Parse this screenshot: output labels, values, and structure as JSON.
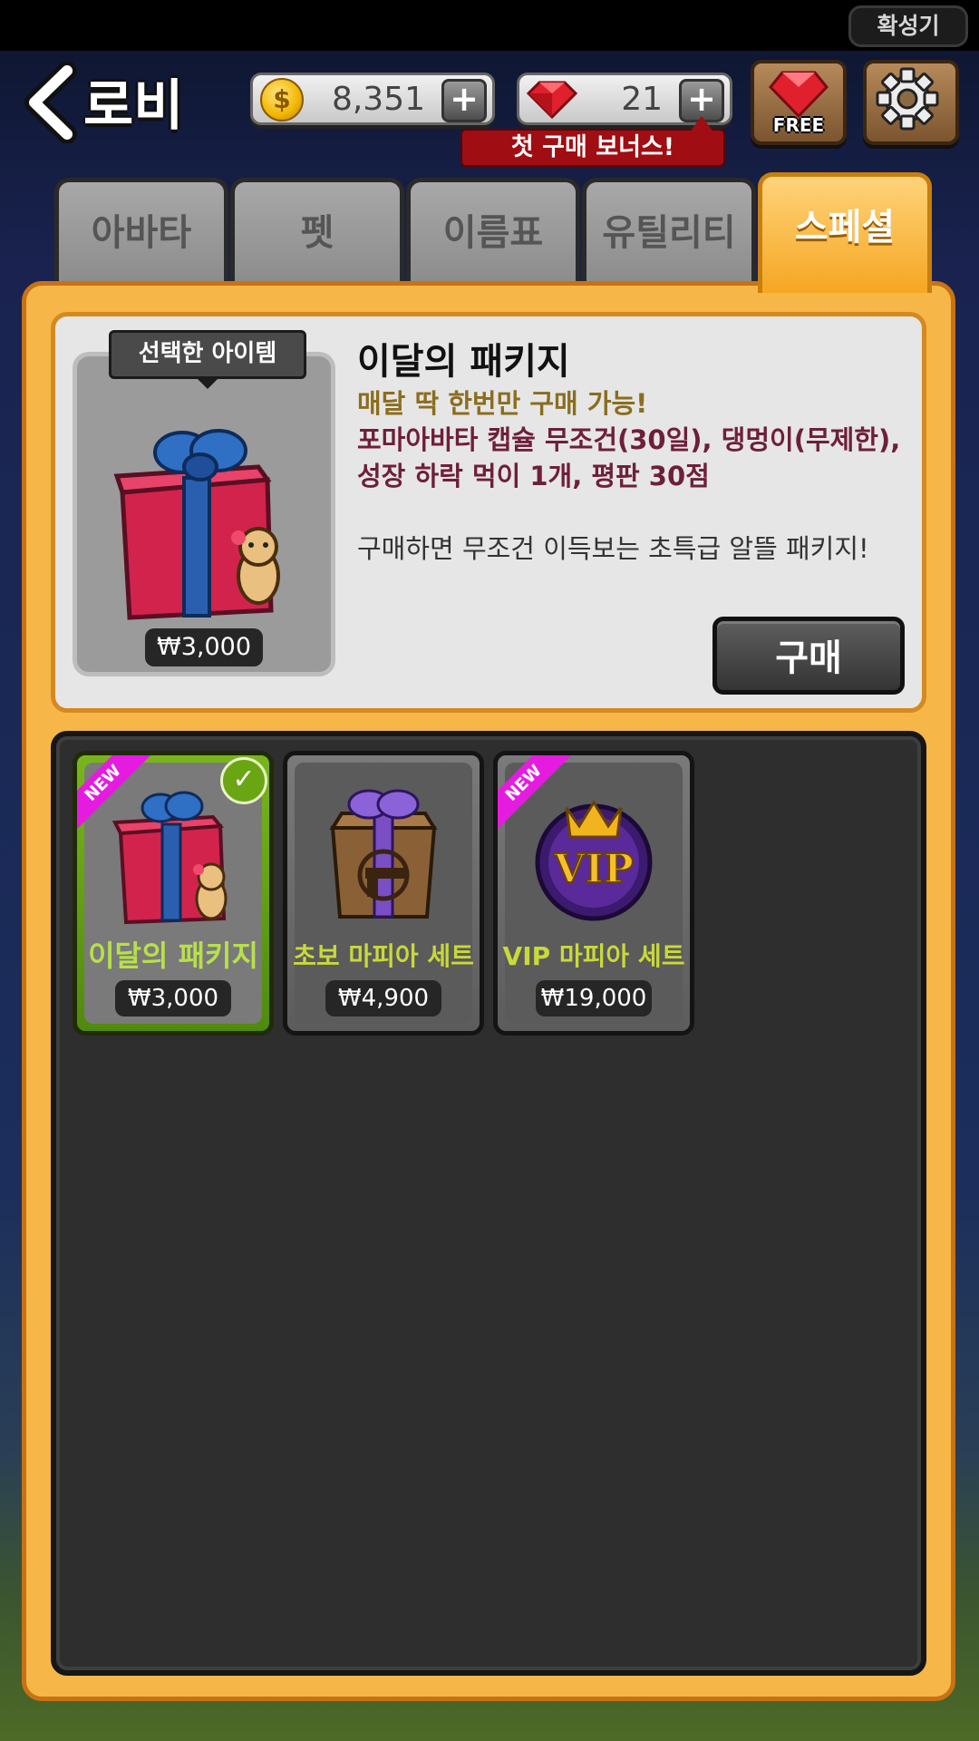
{
  "status_bar": {
    "speaker_label": "확성기"
  },
  "header": {
    "title": "로비",
    "coins": "8,351",
    "gems": "21",
    "first_purchase_bonus": "첫 구매 보너스!",
    "free_label": "FREE",
    "coin_symbol": "$"
  },
  "tabs": [
    {
      "label": "아바타",
      "active": false
    },
    {
      "label": "펫",
      "active": false
    },
    {
      "label": "이름표",
      "active": false
    },
    {
      "label": "유틸리티",
      "active": false
    },
    {
      "label": "스페셜",
      "active": true
    }
  ],
  "detail": {
    "selected_tag": "선택한 아이템",
    "price": "₩3,000",
    "title": "이달의 패키지",
    "line1": "매달 딱 한번만 구매 가능!",
    "line2": "포마아바타 캡슐 무조건(30일), 댕멍이(무제한),",
    "line3": "성장 하락 먹이 1개, 평판 30점",
    "description": "구매하면 무조건 이득보는 초특급 알뜰 패키지!",
    "buy_label": "구매"
  },
  "items": [
    {
      "name": "이달의 패키지",
      "price": "₩3,000",
      "badge": "NEW",
      "selected": true,
      "icon": "gift-box-with-dog"
    },
    {
      "name": "초보 마피아 세트",
      "price": "₩4,900",
      "badge": "",
      "selected": false,
      "icon": "brown-box-gun"
    },
    {
      "name": "VIP 마피아 세트",
      "price": "₩19,000",
      "badge": "NEW",
      "selected": false,
      "icon": "vip-emblem"
    }
  ],
  "colors": {
    "accent_orange": "#f7b648",
    "active_tab": "#f5a623",
    "new_badge": "#e51ce0",
    "selected_green": "#7ab51c",
    "bonus_red": "#a00d12"
  }
}
